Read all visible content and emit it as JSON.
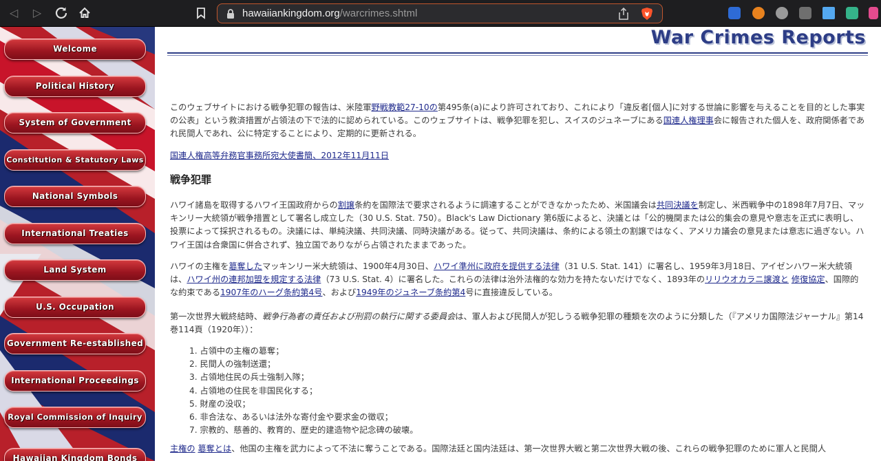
{
  "browser": {
    "url_host": "hawaiiankingdom.org",
    "url_path": "/warcrimes.shtml",
    "back_icon": "back-arrow-icon",
    "forward_icon": "forward-arrow-icon",
    "reload_icon": "reload-icon",
    "home_icon": "home-icon",
    "bookmark_icon": "bookmark-icon",
    "accent_color": "#c2562c"
  },
  "sidebar": {
    "items": [
      {
        "label": "Welcome"
      },
      {
        "label": "Political History"
      },
      {
        "label": "System of Government"
      },
      {
        "label": "Constitution & Statutory Laws"
      },
      {
        "label": "National Symbols"
      },
      {
        "label": "International Treaties"
      },
      {
        "label": "Land System"
      },
      {
        "label": "U.S. Occupation"
      },
      {
        "label": "Government Re-established"
      },
      {
        "label": "International Proceedings"
      },
      {
        "label": "Royal Commission of Inquiry"
      },
      {
        "label": "Hawaiian Kingdom Bonds"
      }
    ]
  },
  "page": {
    "title": "War Crimes Reports",
    "intro": {
      "t1": "このウェブサイトにおける戦争犯罪の報告は、米陸軍",
      "link1": "野戦教範27-10の",
      "t2": "第495条(a)により許可されており、これにより「違反者[個人]に対する世論に影響を与えることを目的とした事実の公表」という救済措置が占領法の下で法的に認められている。このウェブサイトは、戦争犯罪を犯し、スイスのジュネーブにある",
      "link2": "国連人権理事",
      "t3": "会に報告された個人を、政府関係者であれ民間人であれ、公に特定することにより、定期的に更新される。"
    },
    "letter_link": "国連人権高等弁務官事務所宛大使書簡、2012年11月11日",
    "section_heading": "戦争犯罪",
    "p1": {
      "t1": "ハワイ諸島を取得するハワイ王国政府からの",
      "link1": "割譲",
      "t2": "条約を国際法で要求されるように調達することができなかったため、米国議会は",
      "link2": "共同決議を",
      "t3": "制定し、米西戦争中の1898年7月7日、マッキンリー大統領が戦争措置として署名し成立した（30 U.S. Stat. 750）。Black's Law Dictionary 第6版によると、決議とは「公的機関または公的集会の意見や意志を正式に表明し、投票によって採択されるもの。決議には、単純決議、共同決議、同時決議がある。従って、共同決議は、条約による領土の割譲ではなく、アメリカ議会の意見または意志に過ぎない。ハワイ王国は合衆国に併合されず、独立国でありながら占領されたままであった。"
    },
    "p2": {
      "t1": "ハワイの主権を",
      "link1": "簒奪した",
      "t2": "マッキンリー米大統領は、1900年4月30日、",
      "link2": "ハワイ準州に政府を提供する法律",
      "t3": "（31 U.S. Stat. 141）に署名し、1959年3月18日、アイゼンハワー米大統領は、",
      "link3": "ハワイ州の連邦加盟を規定する法律",
      "t4": "（73 U.S. Stat. 4）に署名した。これらの法律は治外法権的な効力を持たないだけでなく、1893年の",
      "link4": "リリウオカラニ譲渡と",
      "t5": " ",
      "link5": "修復協定",
      "t6": "、国際的な約束である",
      "link6": "1907年のハーグ条約第4号",
      "t7": "、および",
      "link7": "1949年のジュネーブ条約第4",
      "t8": "号に直接違反している。"
    },
    "p3": {
      "t1": "第一次世界大戦終結時、",
      "em1": "戦争行為者の責任および刑罰の執行に関する委員会",
      "t2": "は、軍人および民間人が犯しうる戦争犯罪の種類を次のように分類した（『アメリカ国際法ジャーナル』第14巻114頁（1920年））："
    },
    "crimes": [
      "1. 占領中の主権の簒奪；",
      "2. 民間人の強制送還；",
      "3. 占領地住民の兵士強制入隊；",
      "4. 占領地の住民を非国民化する；",
      "5. 財産の没収；",
      "6. 非合法な、あるいは法外な寄付金や要求金の徴収；",
      "7. 宗教的、慈善的、教育的、歴史的建造物や記念碑の破壊。"
    ],
    "p4": {
      "link1": "主権の",
      "t1": " ",
      "link2": "簒奪とは",
      "t2": "、他国の主権を武力によって不法に奪うことである。国際法廷と国内法廷は、第一次世界大戦と第二次世界大戦の後、これらの戦争犯罪のために軍人と民間人"
    }
  }
}
